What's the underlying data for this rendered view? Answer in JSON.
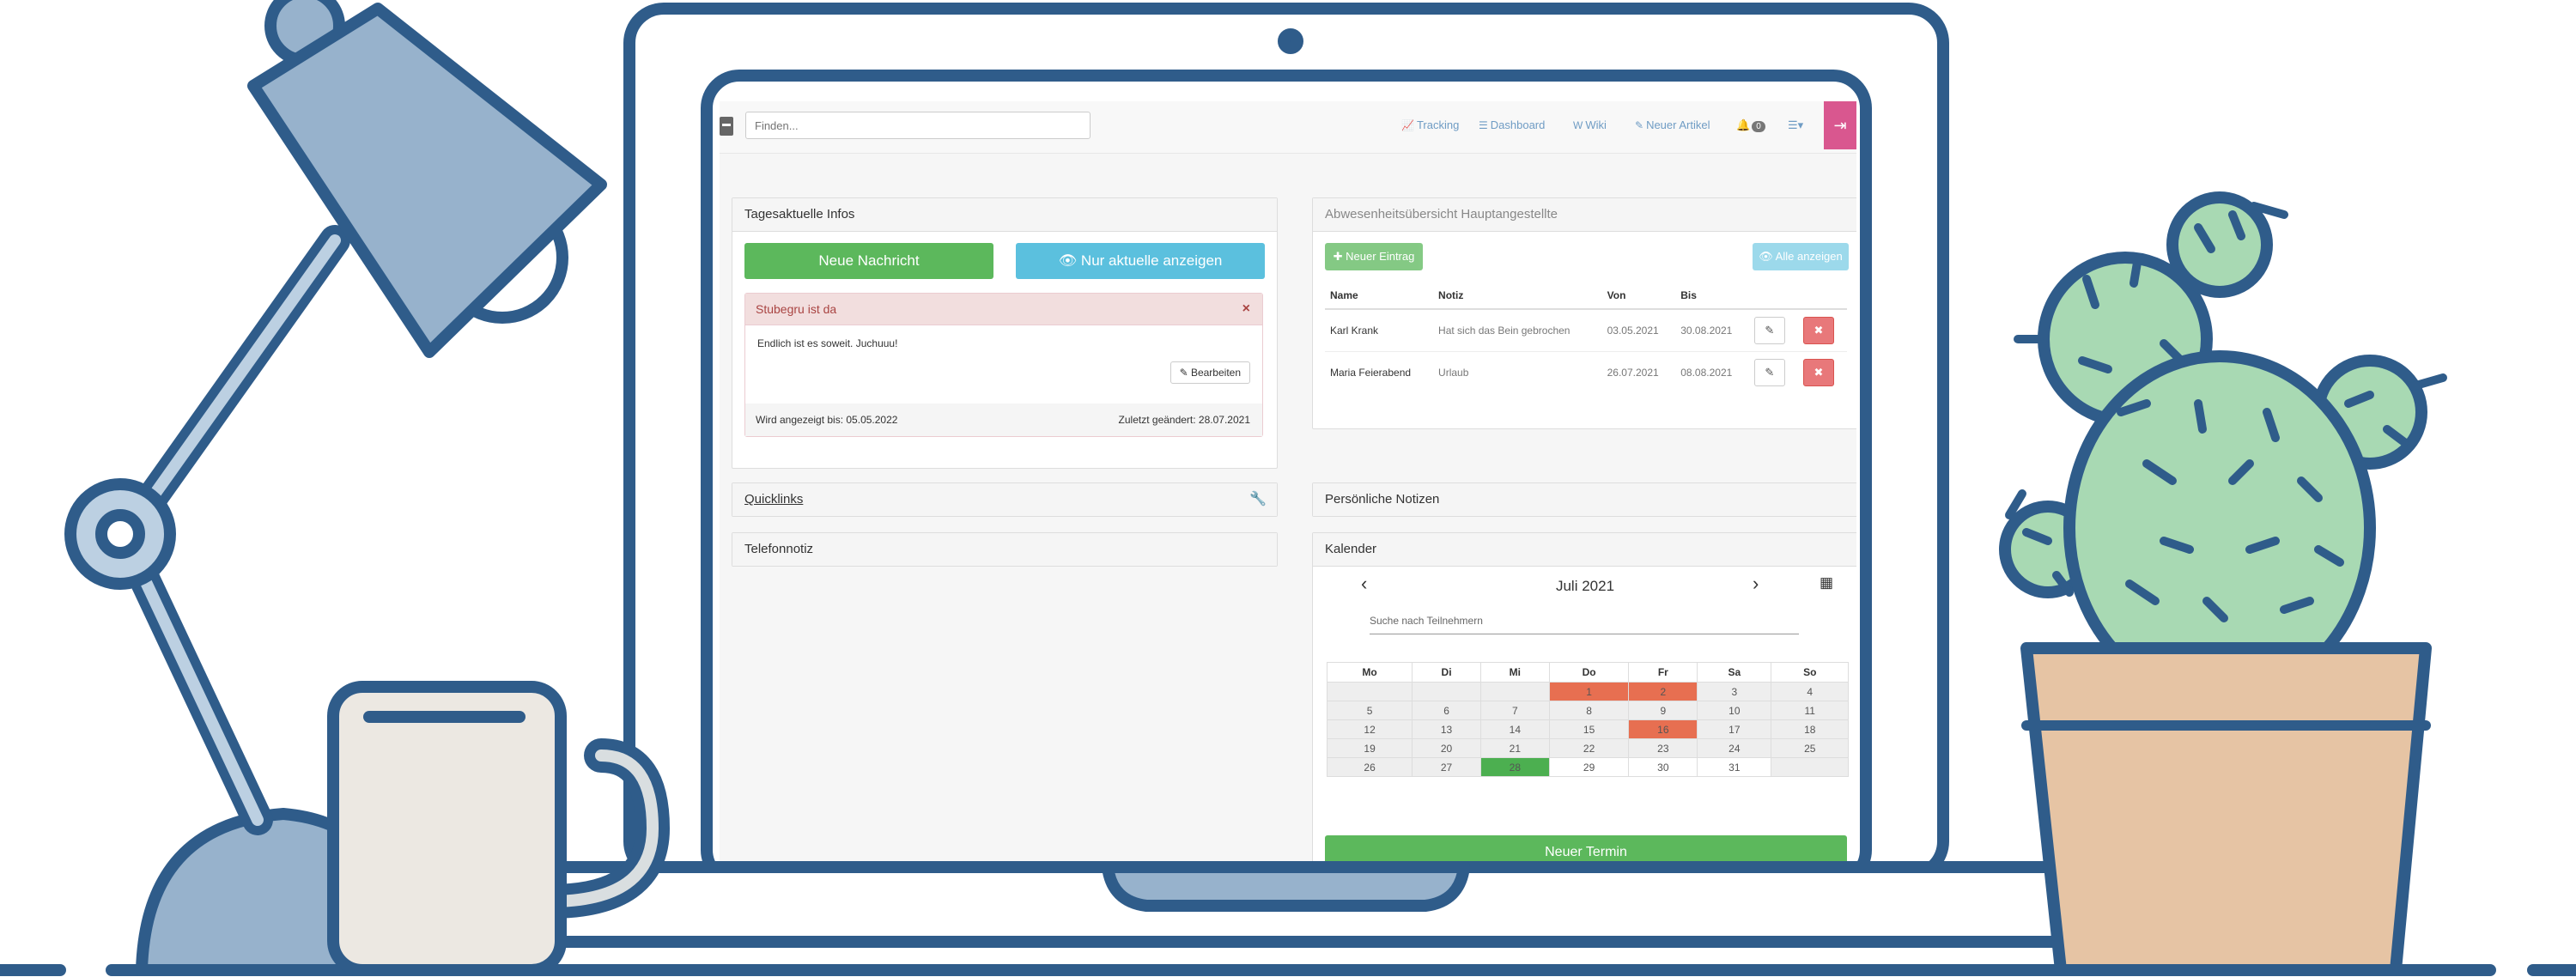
{
  "nav": {
    "search_placeholder": "Finden...",
    "links": [
      {
        "icon": "chart-icon",
        "glyph": "📈",
        "label": "Tracking"
      },
      {
        "icon": "list-icon",
        "glyph": "☰",
        "label": "Dashboard"
      },
      {
        "icon": "wiki-icon",
        "glyph": "W",
        "label": "Wiki"
      },
      {
        "icon": "pencil-icon",
        "glyph": "✎",
        "label": "Neuer Artikel"
      }
    ],
    "notifications_count": "0",
    "menu_glyph": "☰▾",
    "logout_glyph": "⇥"
  },
  "news": {
    "title": "Tagesaktuelle Infos",
    "new_button": "Neue Nachricht",
    "show_current_button": "Nur aktuelle anzeigen",
    "message": {
      "title": "Stubegru ist da",
      "body": "Endlich ist es soweit. Juchuuu!",
      "edit_button": "Bearbeiten",
      "shown_until": "Wird angezeigt bis: 05.05.2022",
      "last_changed": "Zuletzt geändert: 28.07.2021"
    }
  },
  "quicklinks": {
    "title": "Quicklinks"
  },
  "phone_note": {
    "title": "Telefonnotiz"
  },
  "absence": {
    "title": "Abwesenheitsübersicht Hauptangestellte",
    "new_button": "Neuer Eintrag",
    "show_all_button": "Alle anzeigen",
    "columns": [
      "Name",
      "Notiz",
      "Von",
      "Bis"
    ],
    "rows": [
      {
        "name": "Karl Krank",
        "note": "Hat sich das Bein gebrochen",
        "from": "03.05.2021",
        "to": "30.08.2021"
      },
      {
        "name": "Maria Feierabend",
        "note": "Urlaub",
        "from": "26.07.2021",
        "to": "08.08.2021"
      }
    ]
  },
  "personal_notes": {
    "title": "Persönliche Notizen"
  },
  "calendar": {
    "title": "Kalender",
    "month": "Juli 2021",
    "search_placeholder": "Suche nach Teilnehmern",
    "weekdays": [
      "Mo",
      "Di",
      "Mi",
      "Do",
      "Fr",
      "Sa",
      "So"
    ],
    "weeks": [
      [
        "",
        "",
        "",
        "1",
        "2",
        "3",
        "4"
      ],
      [
        "5",
        "6",
        "7",
        "8",
        "9",
        "10",
        "11"
      ],
      [
        "12",
        "13",
        "14",
        "15",
        "16",
        "17",
        "18"
      ],
      [
        "19",
        "20",
        "21",
        "22",
        "23",
        "24",
        "25"
      ],
      [
        "26",
        "27",
        "28",
        "29",
        "30",
        "31",
        ""
      ]
    ],
    "event_days": [
      "1",
      "2",
      "16"
    ],
    "today": "28",
    "new_button": "Neuer Termin"
  },
  "colors": {
    "green": "#5cb85c",
    "blue": "#5bc0de",
    "danger": "#d9534f",
    "event": "#e76f51",
    "today": "#4caf50",
    "outline": "#2f5c8a"
  }
}
